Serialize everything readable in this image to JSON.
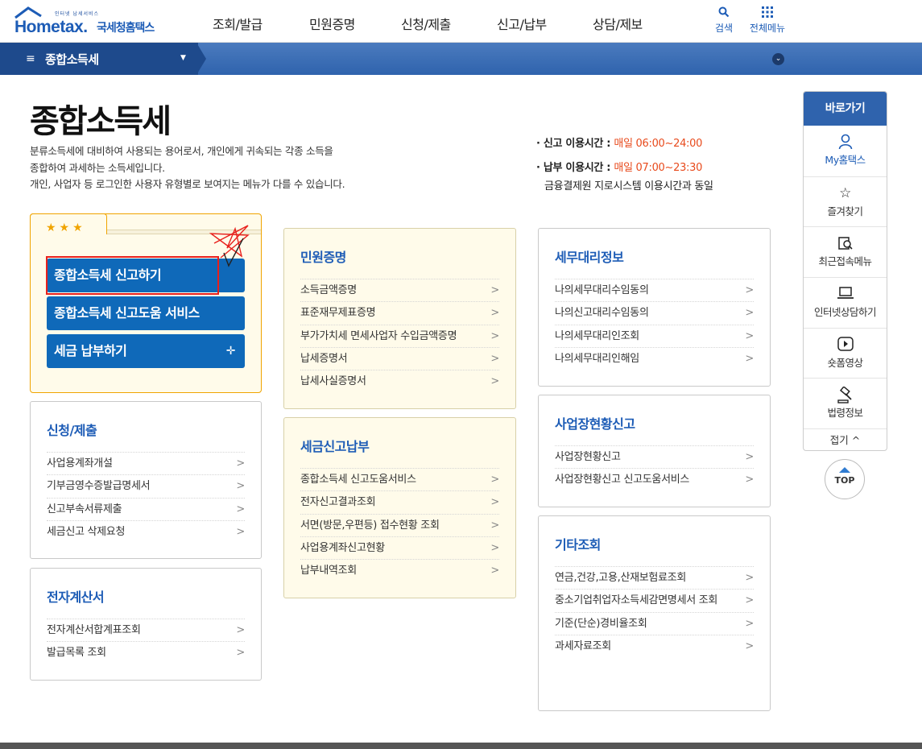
{
  "header": {
    "logo_small": "인터넷 납세서비스",
    "logo_brand": "Hometax.",
    "logo_korean": "국세청홈택스",
    "nav": [
      "조회/발급",
      "민원증명",
      "신청/제출",
      "신고/납부",
      "상담/제보"
    ],
    "search_label": "검색",
    "all_menu_label": "전체메뉴"
  },
  "subbar": {
    "title": "종합소득세"
  },
  "page": {
    "title": "종합소득세",
    "description": [
      "분류소득세에 대비하여 사용되는 용어로서, 개인에게 귀속되는 각종 소득을",
      "종합하여 과세하는 소득세입니다.",
      "개인, 사업자 등 로그인한 사용자 유형별로 보여지는 메뉴가 다를 수 있습니다."
    ],
    "times": {
      "report_label": "· 신고 이용시간 : ",
      "report_value": "매일 06:00~24:00",
      "pay_label": "· 납부 이용시간 : ",
      "pay_value": "매일 07:00~23:30",
      "pay_note": "금융결제원 지로시스템 이용시간과 동일"
    }
  },
  "favorites": {
    "stars": "★★★",
    "buttons": [
      "종합소득세 신고하기",
      "종합소득세 신고도움 서비스",
      "세금 납부하기"
    ],
    "plus": "✛"
  },
  "panels": {
    "apply": {
      "title": "신청/제출",
      "items": [
        "사업용계좌개설",
        "기부금영수증발급명세서",
        "신고부속서류제출",
        "세금신고 삭제요청"
      ]
    },
    "einvoice": {
      "title": "전자계산서",
      "items": [
        "전자계산서합계표조회",
        "발급목록 조회"
      ]
    },
    "certificate": {
      "title": "민원증명",
      "items": [
        "소득금액증명",
        "표준재무제표증명",
        "부가가치세 면세사업자 수입금액증명",
        "납세증명서",
        "납세사실증명서"
      ]
    },
    "report_pay": {
      "title": "세금신고납부",
      "items": [
        "종합소득세 신고도움서비스",
        "전자신고결과조회",
        "서면(방문,우편등) 접수현황 조회",
        "사업용계좌신고현황",
        "납부내역조회"
      ]
    },
    "agent": {
      "title": "세무대리정보",
      "items": [
        "나의세무대리수임동의",
        "나의신고대리수임동의",
        "나의세무대리인조회",
        "나의세무대리인해임"
      ]
    },
    "site_report": {
      "title": "사업장현황신고",
      "items": [
        "사업장현황신고",
        "사업장현황신고 신고도움서비스"
      ]
    },
    "etc": {
      "title": "기타조회",
      "items": [
        "연금,건강,고용,산재보험료조회",
        "중소기업취업자소득세감면명세서 조회",
        "기준(단순)경비율조회",
        "과세자료조회"
      ]
    }
  },
  "quick": {
    "title": "바로가기",
    "items": [
      {
        "label": "My홈택스",
        "icon": "person-icon"
      },
      {
        "label": "즐겨찾기",
        "icon": "star-icon"
      },
      {
        "label": "최근접속메뉴",
        "icon": "recent-icon"
      },
      {
        "label": "인터넷상담하기",
        "icon": "laptop-icon"
      },
      {
        "label": "숏폼영상",
        "icon": "play-icon"
      },
      {
        "label": "법령정보",
        "icon": "gavel-icon"
      }
    ],
    "fold": "접기 ^",
    "top": "TOP"
  },
  "colors": {
    "brand": "#1d5cb6",
    "button": "#0f69b9",
    "accent_red": "#e84a1c",
    "favorite_border": "#f0a400"
  }
}
